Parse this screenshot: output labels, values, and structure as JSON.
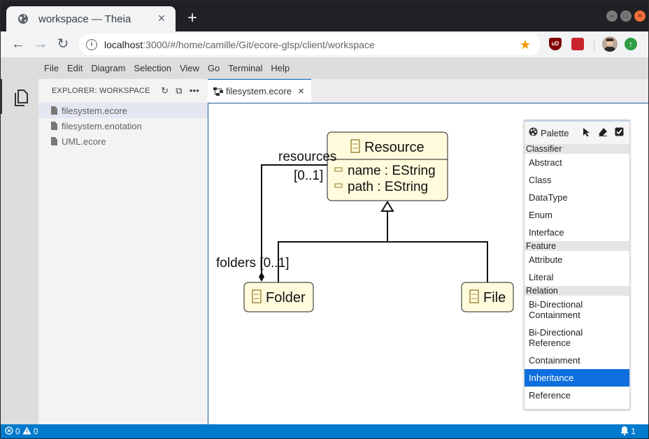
{
  "browser": {
    "tab_title": "workspace — Theia",
    "url_host": "localhost",
    "url_path": ":3000/#/home/camille/Git/ecore-glsp/client/workspace",
    "ublock_label": "uD"
  },
  "menubar": {
    "items": [
      "File",
      "Edit",
      "Diagram",
      "Selection",
      "View",
      "Go",
      "Terminal",
      "Help"
    ]
  },
  "explorer": {
    "title": "EXPLORER: WORKSPACE",
    "files": [
      "filesystem.ecore",
      "filesystem.enotation",
      "UML.ecore"
    ]
  },
  "editor": {
    "tab_label": "filesystem.ecore"
  },
  "diagram": {
    "classes": {
      "resource": "Resource",
      "folder": "Folder",
      "file": "File"
    },
    "attributes": [
      "name : EString",
      "path : EString"
    ],
    "edge_labels": {
      "resources_name": "resources",
      "resources_mult": "[0..1]",
      "folders": "folders [0..1]"
    }
  },
  "palette": {
    "title": "Palette",
    "groups": [
      {
        "label": "Classifier",
        "items": [
          "Abstract",
          "Class",
          "DataType",
          "Enum",
          "Interface"
        ]
      },
      {
        "label": "Feature",
        "items": [
          "Attribute",
          "Literal"
        ]
      },
      {
        "label": "Relation",
        "items": [
          "Bi-Directional Containment",
          "Bi-Directional Reference",
          "Containment",
          "Inheritance",
          "Reference"
        ]
      }
    ],
    "active_item": "Inheritance"
  },
  "statusbar": {
    "errors": "0",
    "warnings": "0",
    "notifications": "1"
  },
  "colors": {
    "accent": "#007acc",
    "class_fill": "#fffbdc",
    "palette_active": "#0f6fde"
  }
}
